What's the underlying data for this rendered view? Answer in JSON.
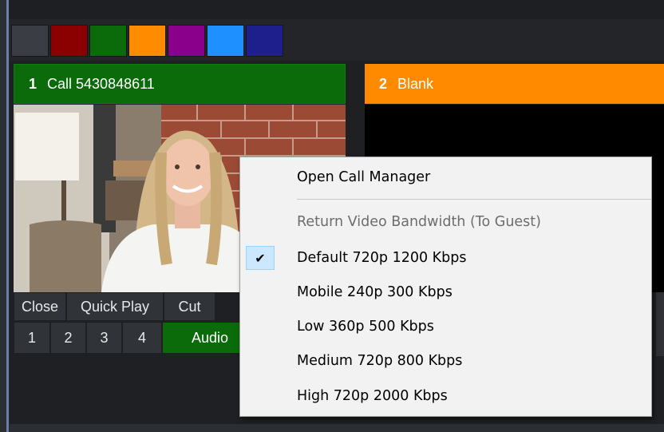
{
  "swatches": {
    "colors": [
      "#3a3d43",
      "#8b0000",
      "#0b6b0b",
      "#ff8c00",
      "#8b008b",
      "#1e90ff",
      "#1e1e8c"
    ]
  },
  "inputs": [
    {
      "number": "1",
      "title": "Call 5430848611",
      "color": "#0b6b0b"
    },
    {
      "number": "2",
      "title": "Blank",
      "color": "#ff8a00"
    }
  ],
  "input1_controls": {
    "close": "Close",
    "quick_play": "Quick Play",
    "cut": "Cut",
    "overlays": [
      "1",
      "2",
      "3",
      "4"
    ],
    "audio": "Audio"
  },
  "context_menu": {
    "open_call_manager": "Open Call Manager",
    "bandwidth_header": "Return Video Bandwidth (To Guest)",
    "options": [
      {
        "label": "Default 720p 1200 Kbps",
        "checked": true
      },
      {
        "label": "Mobile 240p 300 Kbps",
        "checked": false
      },
      {
        "label": "Low 360p 500 Kbps",
        "checked": false
      },
      {
        "label": "Medium 720p 800 Kbps",
        "checked": false
      },
      {
        "label": "High 720p 2000 Kbps",
        "checked": false
      }
    ],
    "check_icon": "checkmark-icon"
  }
}
